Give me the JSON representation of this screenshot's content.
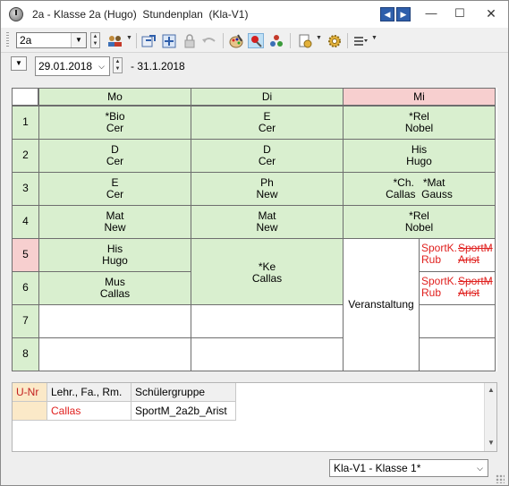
{
  "window": {
    "title": "2a - Klasse 2a (Hugo)  Stundenplan  (Kla-V1)"
  },
  "toolbar": {
    "class_value": "2a",
    "icons": [
      "persons-icon",
      "import-icon",
      "expand-icon",
      "lock-icon",
      "undo-icon",
      "palette-icon",
      "pin-icon",
      "share-icon",
      "page-settings-icon",
      "gear-icon",
      "list-menu-icon"
    ]
  },
  "datebar": {
    "from_date": "29.01.2018",
    "to_date": "- 31.1.2018"
  },
  "timetable": {
    "days": [
      "Mo",
      "Di",
      "Mi"
    ],
    "highlighted_day": "Mi",
    "periods": [
      "1",
      "2",
      "3",
      "4",
      "5",
      "6",
      "7",
      "8"
    ],
    "highlighted_period": "5",
    "mo": [
      [
        "*Bio",
        "Cer"
      ],
      [
        "D",
        "Cer"
      ],
      [
        "E",
        "Cer"
      ],
      [
        "Mat",
        "New"
      ],
      [
        "His",
        "Hugo"
      ],
      [
        "Mus",
        "Callas"
      ]
    ],
    "di": [
      [
        "E",
        "Cer"
      ],
      [
        "D",
        "Cer"
      ],
      [
        "Ph",
        "New"
      ],
      [
        "Mat",
        "New"
      ],
      [
        "*Ke",
        "Callas"
      ]
    ],
    "mi": [
      [
        "*Rel",
        "Nobel"
      ],
      [
        "His",
        "Hugo"
      ],
      [
        "*Ch.   *Mat",
        "Callas  Gauss"
      ],
      [
        "*Rel",
        "Nobel"
      ]
    ],
    "event": "Veranstaltung",
    "sport": {
      "left_subject": "SportK.",
      "left_teacher": "Rub",
      "right_subject": "SportM",
      "right_teacher": "Arist"
    }
  },
  "detail": {
    "headers": [
      "U-Nr",
      "Lehr., Fa., Rm.",
      "Schülergruppe"
    ],
    "rows": [
      {
        "unr": "",
        "teacher": "Callas",
        "group": "SportM_2a2b_Arist"
      }
    ]
  },
  "footer": {
    "view_select": "Kla-V1 - Klasse 1*"
  },
  "colors": {
    "lesson_green": "#d9efcf",
    "highlight_red": "#f7cfcf",
    "red_text": "#e0201e"
  }
}
